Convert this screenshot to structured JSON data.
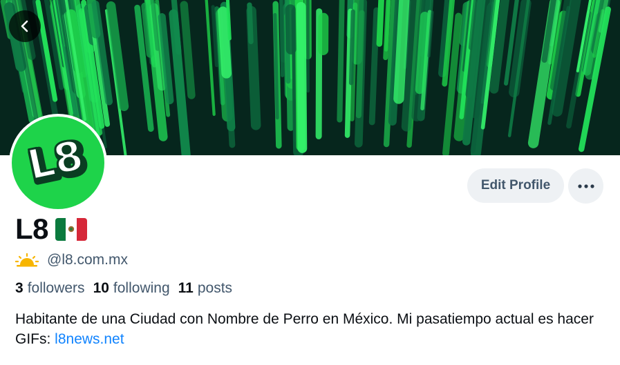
{
  "profile": {
    "display_name": "L8",
    "name_emoji": "mexico-flag",
    "handle_emoji": "sunrise-icon",
    "handle": "@l8.com.mx",
    "avatar_text": "L8",
    "stats": {
      "followers_count": "3",
      "followers_label": "followers",
      "following_count": "10",
      "following_label": "following",
      "posts_count": "11",
      "posts_label": "posts"
    },
    "bio_text": "Habitante de una Ciudad con Nombre de Perro en México. Mi pasatiempo actual es hacer GIFs: ",
    "bio_link": "l8news.net"
  },
  "actions": {
    "edit_profile_label": "Edit Profile"
  },
  "colors": {
    "accent_green": "#1ed34a",
    "link_blue": "#1083fe",
    "button_bg": "#eef1f4",
    "secondary_text": "#42576c"
  }
}
